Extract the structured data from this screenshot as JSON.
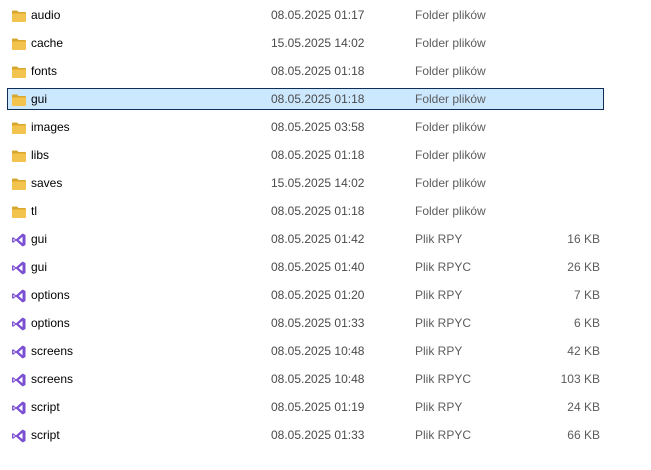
{
  "colors": {
    "folder": "#f2c44d",
    "folder_dark": "#d9a72e",
    "script_icon": "#7a4fd1",
    "selection_bg": "#cce8ff",
    "selection_border": "#0f2d55"
  },
  "files": [
    {
      "name": "audio",
      "date": "08.05.2025 01:17",
      "type": "Folder plików",
      "size": "",
      "icon": "folder-icon",
      "selected": false
    },
    {
      "name": "cache",
      "date": "15.05.2025 14:02",
      "type": "Folder plików",
      "size": "",
      "icon": "folder-icon",
      "selected": false
    },
    {
      "name": "fonts",
      "date": "08.05.2025 01:18",
      "type": "Folder plików",
      "size": "",
      "icon": "folder-icon",
      "selected": false
    },
    {
      "name": "gui",
      "date": "08.05.2025 01:18",
      "type": "Folder plików",
      "size": "",
      "icon": "folder-icon",
      "selected": true
    },
    {
      "name": "images",
      "date": "08.05.2025 03:58",
      "type": "Folder plików",
      "size": "",
      "icon": "folder-icon",
      "selected": false
    },
    {
      "name": "libs",
      "date": "08.05.2025 01:18",
      "type": "Folder plików",
      "size": "",
      "icon": "folder-icon",
      "selected": false
    },
    {
      "name": "saves",
      "date": "15.05.2025 14:02",
      "type": "Folder plików",
      "size": "",
      "icon": "folder-icon",
      "selected": false
    },
    {
      "name": "tl",
      "date": "08.05.2025 01:18",
      "type": "Folder plików",
      "size": "",
      "icon": "folder-icon",
      "selected": false
    },
    {
      "name": "gui",
      "date": "08.05.2025 01:42",
      "type": "Plik RPY",
      "size": "16 KB",
      "icon": "visual-studio-file-icon",
      "selected": false
    },
    {
      "name": "gui",
      "date": "08.05.2025 01:40",
      "type": "Plik RPYC",
      "size": "26 KB",
      "icon": "visual-studio-file-icon",
      "selected": false
    },
    {
      "name": "options",
      "date": "08.05.2025 01:20",
      "type": "Plik RPY",
      "size": "7 KB",
      "icon": "visual-studio-file-icon",
      "selected": false
    },
    {
      "name": "options",
      "date": "08.05.2025 01:33",
      "type": "Plik RPYC",
      "size": "6 KB",
      "icon": "visual-studio-file-icon",
      "selected": false
    },
    {
      "name": "screens",
      "date": "08.05.2025 10:48",
      "type": "Plik RPY",
      "size": "42 KB",
      "icon": "visual-studio-file-icon",
      "selected": false
    },
    {
      "name": "screens",
      "date": "08.05.2025 10:48",
      "type": "Plik RPYC",
      "size": "103 KB",
      "icon": "visual-studio-file-icon",
      "selected": false
    },
    {
      "name": "script",
      "date": "08.05.2025 01:19",
      "type": "Plik RPY",
      "size": "24 KB",
      "icon": "visual-studio-file-icon",
      "selected": false
    },
    {
      "name": "script",
      "date": "08.05.2025 01:33",
      "type": "Plik RPYC",
      "size": "66 KB",
      "icon": "visual-studio-file-icon",
      "selected": false
    }
  ]
}
